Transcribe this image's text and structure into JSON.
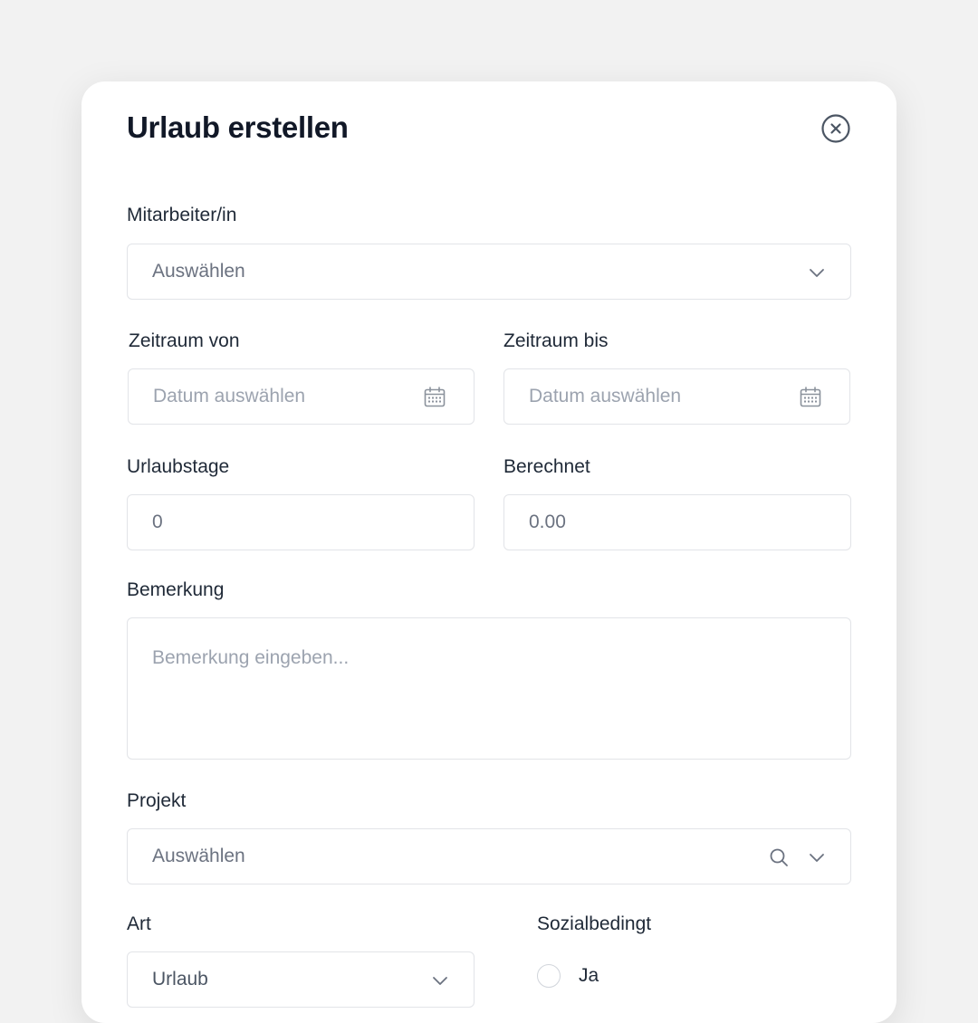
{
  "modal": {
    "title": "Urlaub erstellen"
  },
  "employee": {
    "label": "Mitarbeiter/in",
    "placeholder": "Auswählen"
  },
  "period_from": {
    "label": "Zeitraum von",
    "placeholder": "Datum auswählen"
  },
  "period_to": {
    "label": "Zeitraum bis",
    "placeholder": "Datum auswählen"
  },
  "vacation_days": {
    "label": "Urlaubstage",
    "value": "0"
  },
  "calculated": {
    "label": "Berechnet",
    "value": "0.00"
  },
  "remark": {
    "label": "Bemerkung",
    "placeholder": "Bemerkung eingeben..."
  },
  "project": {
    "label": "Projekt",
    "placeholder": "Auswählen"
  },
  "type": {
    "label": "Art",
    "value": "Urlaub"
  },
  "social": {
    "label": "Sozialbedingt",
    "option_yes": "Ja"
  },
  "icons": {
    "close": "close-circle-icon",
    "dropdown": "chevron-down-icon",
    "calendar": "calendar-icon",
    "search": "search-icon"
  },
  "colors": {
    "background": "#f2f2f2",
    "card": "#ffffff",
    "text": "#111827",
    "placeholder": "#9ca3af",
    "border": "#e2e4e8"
  }
}
